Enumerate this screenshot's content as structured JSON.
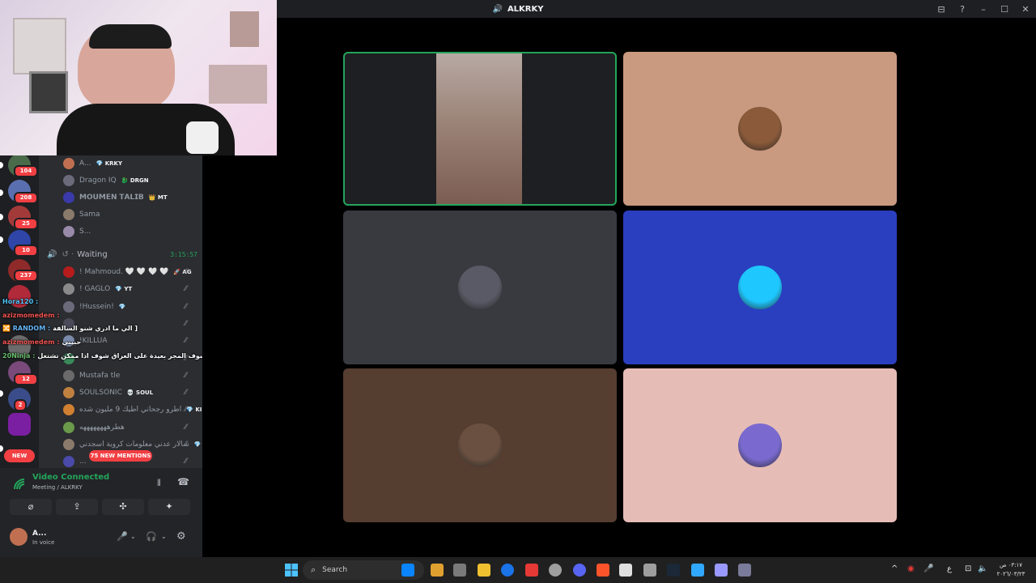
{
  "titlebar": {
    "title": "ALKRKY",
    "controls": [
      "⊟",
      "?",
      "–",
      "☐",
      "✕"
    ]
  },
  "servers": [
    {
      "badge": "104",
      "color": "#4a6b4a"
    },
    {
      "badge": "208",
      "color": "#5a6fb0"
    },
    {
      "badge": "25",
      "color": "#a33a3a"
    },
    {
      "badge": "10",
      "color": "#2f45a8"
    },
    {
      "badge": "237",
      "color": "#8e2a2a"
    },
    {
      "badge": "",
      "color": "#b02a3a"
    },
    {
      "badge": "",
      "color": "#6b6b6b"
    },
    {
      "badge": "12",
      "color": "#7a4a7a"
    },
    {
      "badge": "2",
      "color": "#3a4d8a"
    },
    {
      "badge": "",
      "color": "#7b1fa2"
    }
  ],
  "new_label": "NEW",
  "mentions_label": "75 NEW MENTIONS",
  "members_top": [
    {
      "name": "A...",
      "tag": "💎 KRKY",
      "color": "#c07050"
    },
    {
      "name": "Dragon IQ",
      "tag": "🐉 DRGN",
      "color": "#6a6a7a"
    },
    {
      "name": "𝗠𝗢𝗨𝗠𝗘𝗡 𝗧𝗔𝗟𝗜𝗕",
      "tag": "👑 MT",
      "color": "#3a3aaa"
    },
    {
      "name": "Sama",
      "tag": "",
      "color": "#8a7a6a"
    },
    {
      "name": "S...",
      "tag": "",
      "color": "#9a8aaa"
    }
  ],
  "waiting": {
    "label": "Waiting",
    "timer": "3:15:57"
  },
  "members_waiting": [
    {
      "name": "! Mahmoud. 🤍 🤍 🤍 🤍",
      "tag": "🚀 AG",
      "color": "#b71c1c"
    },
    {
      "name": "! GAGLO",
      "tag": "💎 YT",
      "color": "#8a8a8a"
    },
    {
      "name": "!Hussein!",
      "tag": "💎",
      "color": "#6a6a7a"
    },
    {
      "name": "",
      "tag": "",
      "color": "#4a4a5a"
    },
    {
      "name": "!KILLUA",
      "tag": "",
      "color": "#7a8aaa"
    },
    {
      "name": "",
      "tag": "",
      "color": "#3a8a5a"
    },
    {
      "name": "Mustafa tle",
      "tag": "",
      "color": "#6a6a6a"
    },
    {
      "name": "SOULSONIC",
      "tag": "💀 SOUL",
      "color": "#c08040"
    },
    {
      "name": "اطرو رجحاني اطيك 9 مليون شده",
      "tag": "💎 KI",
      "color": "#d08030"
    },
    {
      "name": "هطرههههههههه",
      "tag": "",
      "color": "#6a9a4a"
    },
    {
      "name": "سالار عدني معلومات كروية اسجدني",
      "tag": "💎",
      "color": "#8a7a6a"
    },
    {
      "name": "...",
      "tag": "",
      "color": "#4a4aaa"
    }
  ],
  "chat": [
    {
      "name": "Hora120 :",
      "msg": "",
      "color": "#4fc3f7"
    },
    {
      "name": "azizmomedem :",
      "msg": "",
      "color": "#ef5350"
    },
    {
      "name": "🔀 RANDOM :",
      "msg": "الي ما ادري شنو السالفة ]",
      "color": "#64b5f6"
    },
    {
      "name": "azizmomedem :",
      "msg": "حبيبي",
      "color": "#ef5350"
    },
    {
      "name": "20Ninja :",
      "msg": "شوف المجر بعيدة على العراق شوف اذا ممكن تشتغل",
      "color": "#66bb6a"
    }
  ],
  "voice": {
    "status": "Video Connected",
    "location": "Meeting / ALKRKY",
    "buttons": [
      "⌀",
      "⇪",
      "✣",
      "✦"
    ]
  },
  "user": {
    "name": "A...",
    "status": "In voice"
  },
  "tiles": [
    {
      "bg": "#1e1f22",
      "kind": "video",
      "avatar": "#b08a7a"
    },
    {
      "bg": "#c99a7f",
      "kind": "avatar",
      "avatar": "#8a5a3a"
    },
    {
      "bg": "#383a40",
      "kind": "avatar",
      "avatar": "#5a5a66"
    },
    {
      "bg": "#2a3fc0",
      "kind": "avatar",
      "avatar": "#1ec8ff"
    },
    {
      "bg": "#553d30",
      "kind": "avatar",
      "avatar": "#6a5040"
    },
    {
      "bg": "#e6bdb6",
      "kind": "avatar",
      "avatar": "#7a6ad0"
    }
  ],
  "taskbar": {
    "search_label": "Search",
    "apps": [
      "#0a84ff",
      "#e0a030",
      "#7a7a7a",
      "#f0c030",
      "#1a73e8",
      "#e53935",
      "#9e9e9e",
      "#5865f2",
      "#fb542b",
      "#e0e0e0",
      "#9e9e9e",
      "#1b2838",
      "#31a8ff",
      "#9999ff",
      "#7a7a9a"
    ],
    "tray": [
      "^",
      "◉",
      "🎤",
      "ع",
      "⊡",
      "🔈"
    ],
    "clock_time": "٠٣:١٧ ص",
    "clock_date": "٢٠٢٦/٠٣/٢٣"
  }
}
